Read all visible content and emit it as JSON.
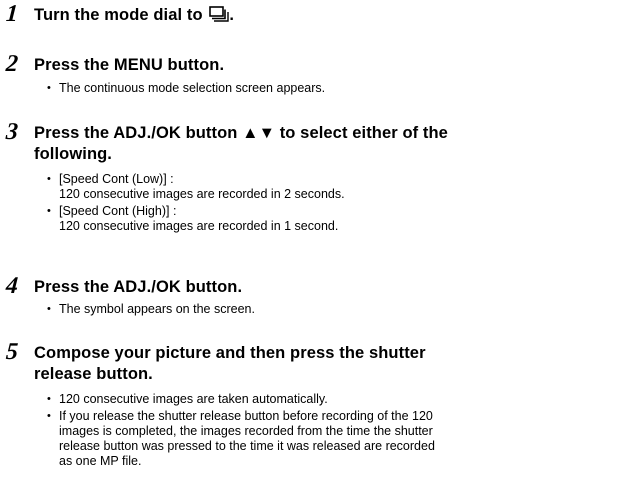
{
  "steps": [
    {
      "num": "1",
      "title": "Turn the mode dial to",
      "title_suffix": ".",
      "icon": "continuous-mode-icon",
      "bullets": []
    },
    {
      "num": "2",
      "title": "Press the MENU button.",
      "bullets": [
        "The continuous mode selection screen appears."
      ]
    },
    {
      "num": "3",
      "title_line1": "Press the ADJ./OK button ▲▼ to select either of the",
      "title_line2": "following.",
      "bullets": [
        {
          "line1": "[Speed Cont (Low)] :",
          "line2": "120 consecutive images are recorded in 2 seconds."
        },
        {
          "line1": "[Speed Cont (High)] :",
          "line2": "120 consecutive images are recorded in 1 second."
        }
      ]
    },
    {
      "num": "4",
      "title": "Press the ADJ./OK button.",
      "bullets": [
        "The symbol appears on the screen."
      ]
    },
    {
      "num": "5",
      "title_line1": "Compose your picture and then press the shutter",
      "title_line2": "release button.",
      "bullets": [
        "120 consecutive images are taken automatically.",
        {
          "line1": "If you release the shutter release button before recording of the 120",
          "line2": "images is completed, the images recorded from the time the shutter",
          "line3": "release button was pressed to the time it was released are recorded",
          "line4": "as one MP file."
        }
      ]
    }
  ]
}
